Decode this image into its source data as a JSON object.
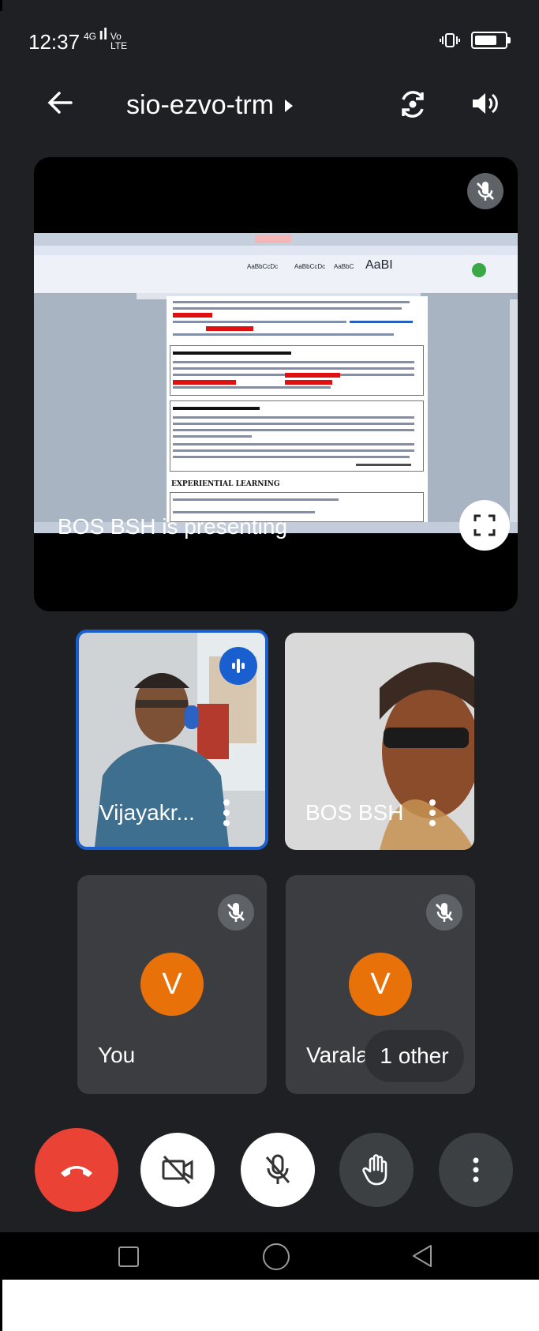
{
  "status_bar": {
    "time": "12:37",
    "network_small": "4G",
    "network_vo": "Vo",
    "network_lte": "LTE",
    "battery_level": 0.8
  },
  "top_bar": {
    "meeting_code": "sio-ezvo-trm"
  },
  "presentation": {
    "presenter_text": "BOS BSH is presenting",
    "document_heading": "EXPERIENTIAL LEARNING"
  },
  "participants": [
    {
      "name": "Vijayakr...",
      "speaking": true
    },
    {
      "name": "BOS BSH",
      "speaking": false
    },
    {
      "name": "You",
      "avatar_letter": "V",
      "muted": true
    },
    {
      "name": "Varala",
      "avatar_letter": "V",
      "muted": true
    }
  ],
  "others_chip": "1 other",
  "controls": {
    "end_call_color": "#ea4335",
    "accent_color": "#1a5fd0",
    "avatar_color": "#e8710a"
  }
}
